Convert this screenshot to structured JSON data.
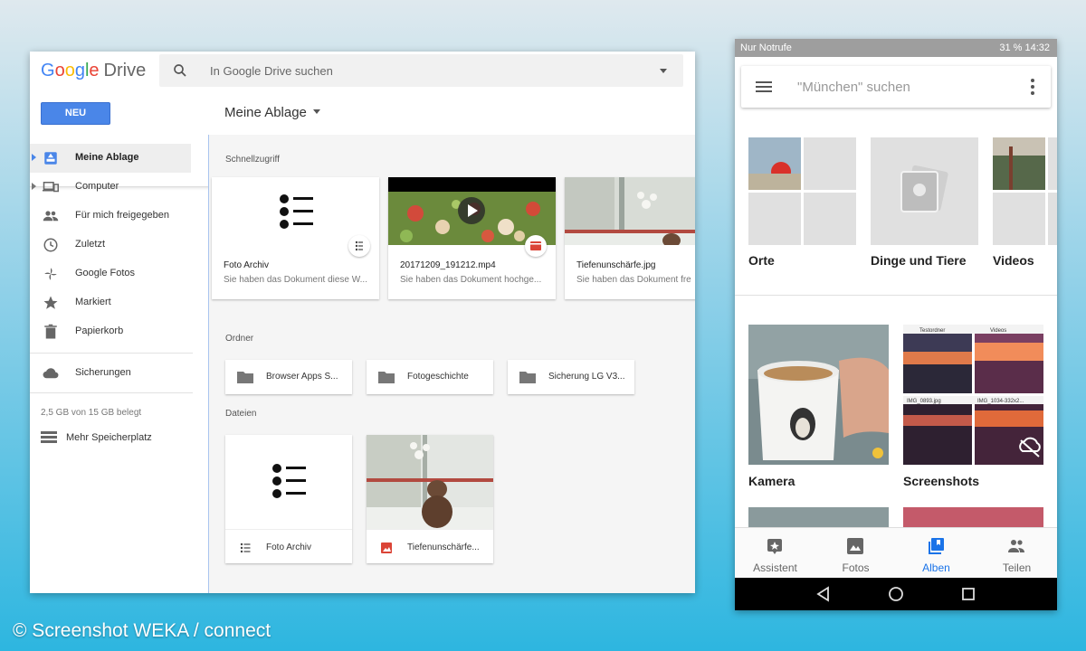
{
  "drive": {
    "logo_google": "Google",
    "logo_drive": "Drive",
    "search_placeholder": "In Google Drive suchen",
    "new_button": "NEU",
    "breadcrumb": "Meine Ablage",
    "nav": [
      {
        "label": "Meine Ablage",
        "icon": "drive-icon"
      },
      {
        "label": "Computer",
        "icon": "computer-icon"
      },
      {
        "label": "Für mich freigegeben",
        "icon": "people-icon"
      },
      {
        "label": "Zuletzt",
        "icon": "clock-icon"
      },
      {
        "label": "Google Fotos",
        "icon": "pinwheel-icon"
      },
      {
        "label": "Markiert",
        "icon": "star-icon"
      },
      {
        "label": "Papierkorb",
        "icon": "trash-icon"
      },
      {
        "label": "Sicherungen",
        "icon": "cloud-icon"
      }
    ],
    "storage_text": "2,5 GB von 15 GB belegt",
    "more_storage": "Mehr Speicherplatz",
    "quick_access_label": "Schnellzugriff",
    "quick_access": [
      {
        "title": "Foto Archiv",
        "subtitle": "Sie haben das Dokument diese W..."
      },
      {
        "title": "20171209_191212.mp4",
        "subtitle": "Sie haben das Dokument hochge..."
      },
      {
        "title": "Tiefenunschärfe.jpg",
        "subtitle": "Sie haben das Dokument fre"
      }
    ],
    "folders_label": "Ordner",
    "folders": [
      "Browser Apps S...",
      "Fotogeschichte",
      "Sicherung LG V3..."
    ],
    "files_label": "Dateien",
    "files": [
      "Foto Archiv",
      "Tiefenunschärfe..."
    ]
  },
  "phone": {
    "status_left": "Nur Notrufe",
    "status_right": "31 %  14:32",
    "search_placeholder": "\"München\" suchen",
    "albums_top": [
      "Orte",
      "Dinge und Tiere",
      "Videos"
    ],
    "albums_bottom": [
      "Kamera",
      "Screenshots"
    ],
    "screenshot_labels": [
      "Testordner",
      "Videos",
      "IMG_0893.jpg",
      "IMG_1034-332x2..."
    ],
    "bottom_nav": [
      "Assistent",
      "Fotos",
      "Alben",
      "Teilen"
    ],
    "active_tab": "Alben"
  },
  "credit": "© Screenshot WEKA / connect",
  "colors": {
    "accent": "#4a86e8",
    "phone_accent": "#1a73e8"
  }
}
